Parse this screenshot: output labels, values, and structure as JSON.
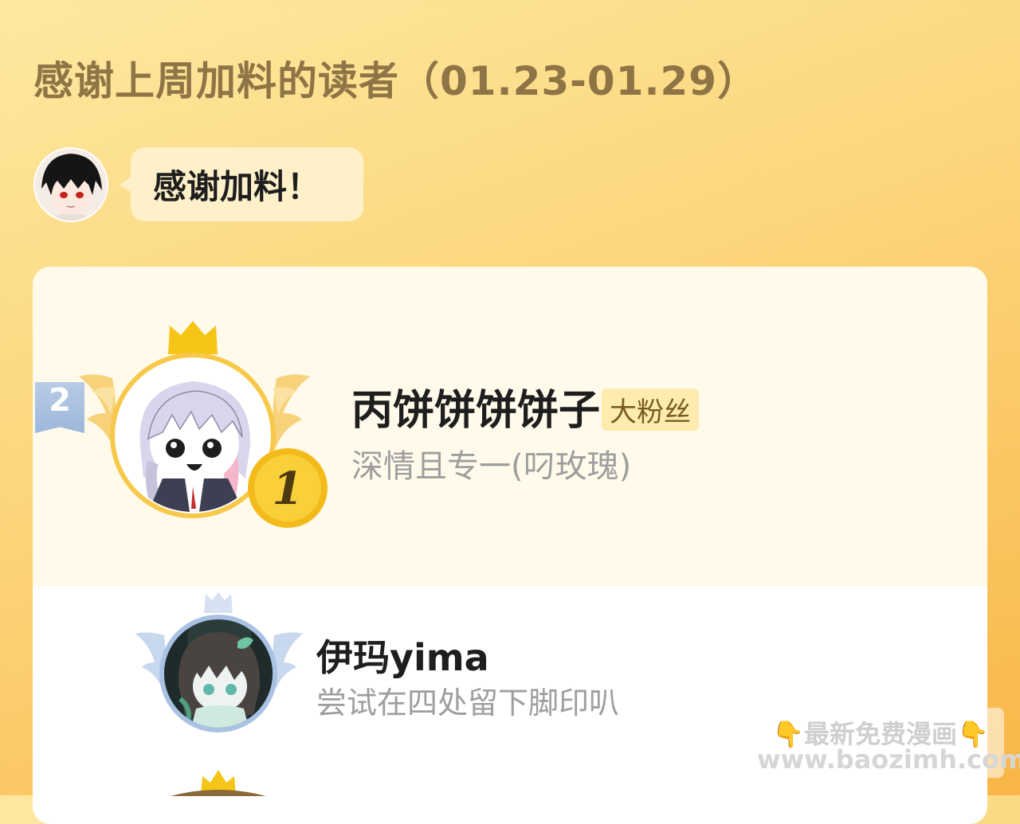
{
  "header": {
    "title": "感谢上周加料的读者（01.23-01.29）"
  },
  "author": {
    "bubble_text": "感谢加料！"
  },
  "ranking": [
    {
      "rank": "1",
      "name": "丙饼饼饼饼子",
      "badge": "大粉丝",
      "motto": "深情且专一(叼玫瑰)"
    },
    {
      "rank": "2",
      "name": "伊玛yima",
      "motto": "尝试在四处留下脚印叭"
    }
  ],
  "watermark": {
    "line1": "👇最新免费漫画👇",
    "line2": "www.baozimh.com"
  },
  "colors": {
    "title": "#8f7446",
    "bubble_bg": "#fef0c8",
    "gold": "#f5c518",
    "silver": "#a9c2e4"
  }
}
